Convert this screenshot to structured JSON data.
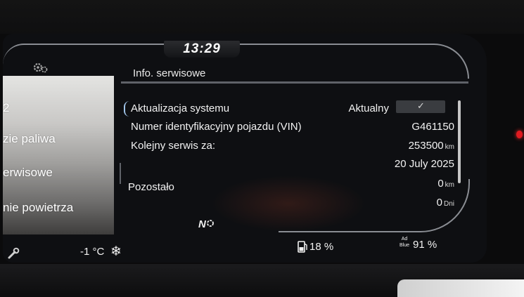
{
  "header": {
    "clock": "13:29"
  },
  "left_menu": {
    "items": [
      {
        "label": "2"
      },
      {
        "label": "zie paliwa"
      },
      {
        "label": "erwisowe"
      },
      {
        "label": "nie powietrza"
      }
    ]
  },
  "service_info": {
    "title": "Info. serwisowe",
    "rows": [
      {
        "label": "Aktualizacja systemu",
        "value": "Aktualny",
        "check": "✓"
      },
      {
        "label": "Numer identyfikacyjny pojazdu (VIN)",
        "value": "G461150"
      },
      {
        "label": "Kolejny serwis za:",
        "value": "253500",
        "unit": "km"
      },
      {
        "label": "",
        "value": "20 July 2025"
      }
    ],
    "remaining": {
      "label": "Pozostało",
      "distance_value": "0",
      "distance_unit": "km",
      "days_value": "0",
      "days_unit": "Dni"
    }
  },
  "status_bar": {
    "outside_temp": "-1 °C",
    "gear": "N",
    "fuel_level": "18 %",
    "adblue_label_top": "Ad",
    "adblue_label_bottom": "Blue",
    "adblue_level": "91 %"
  },
  "icons": {
    "settings": "settings-icon",
    "wrench": "wrench-icon",
    "snowflake": "snowflake-icon",
    "fuel": "fuel-pump-icon"
  },
  "colors": {
    "accent": "#9fc3e8",
    "text": "#f2f2f2",
    "screen_bg": "#0e0f12"
  }
}
